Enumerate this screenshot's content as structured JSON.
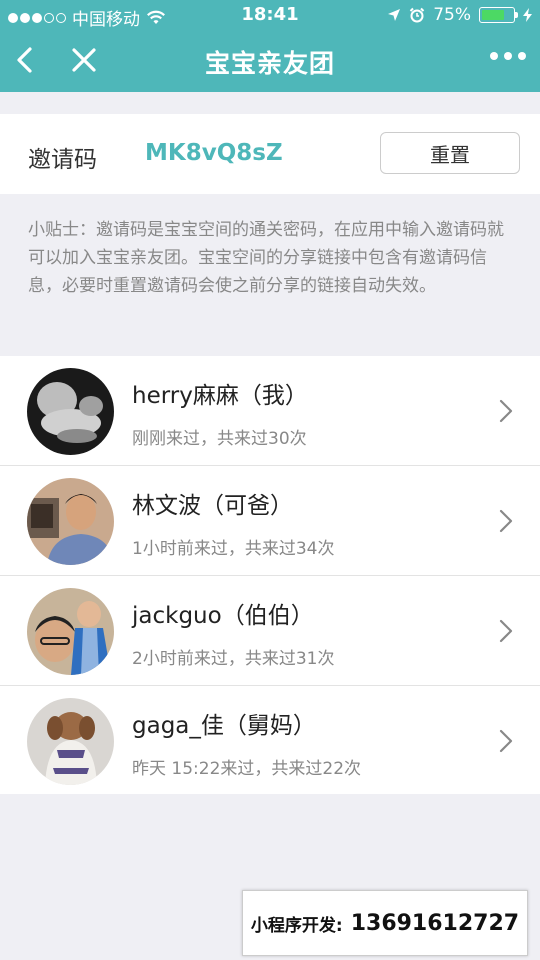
{
  "statusbar": {
    "carrier": "中国移动",
    "time": "18:41",
    "battery": "75%",
    "battery_level": 0.75
  },
  "nav": {
    "title": "宝宝亲友团"
  },
  "invite": {
    "label": "邀请码",
    "code": "MK8vQ8sZ",
    "reset_label": "重置"
  },
  "tip": "小贴士：邀请码是宝宝空间的通关密码，在应用中输入邀请码就可以加入宝宝亲友团。宝宝空间的分享链接中包含有邀请码信息，必要时重置邀请码会使之前分享的链接自动失效。",
  "members": [
    {
      "name": "herry麻麻（我）",
      "visit": "刚刚来过，共来过30次"
    },
    {
      "name": "林文波（可爸）",
      "visit": "1小时前来过，共来过34次"
    },
    {
      "name": "jackguo（伯伯）",
      "visit": "2小时前来过，共来过31次"
    },
    {
      "name": "gaga_佳（舅妈）",
      "visit": "昨天 15:22来过，共来过22次"
    }
  ],
  "promo": {
    "label": "小程序开发:",
    "phone": "13691612727"
  },
  "colors": {
    "accent": "#4eb7b9",
    "background": "#efeff4"
  }
}
